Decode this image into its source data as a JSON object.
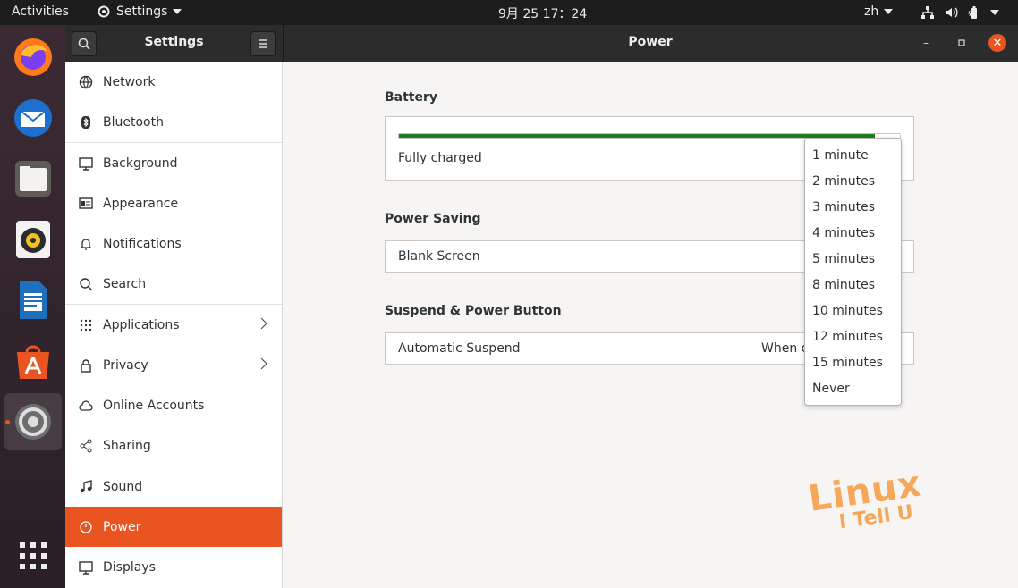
{
  "topbar": {
    "activities": "Activities",
    "app_menu": "Settings",
    "clock": "9月 25  17：24",
    "lang": "zh"
  },
  "sidebar": {
    "title": "Settings",
    "items": [
      {
        "label": "Network",
        "icon": "network-icon"
      },
      {
        "label": "Bluetooth",
        "icon": "bluetooth-icon"
      },
      {
        "label": "Background",
        "icon": "background-icon"
      },
      {
        "label": "Appearance",
        "icon": "appearance-icon"
      },
      {
        "label": "Notifications",
        "icon": "bell-icon"
      },
      {
        "label": "Search",
        "icon": "search-icon"
      },
      {
        "label": "Applications",
        "icon": "grid-icon"
      },
      {
        "label": "Privacy",
        "icon": "lock-icon"
      },
      {
        "label": "Online Accounts",
        "icon": "cloud-icon"
      },
      {
        "label": "Sharing",
        "icon": "share-icon"
      },
      {
        "label": "Sound",
        "icon": "music-icon"
      },
      {
        "label": "Power",
        "icon": "power-icon"
      },
      {
        "label": "Displays",
        "icon": "display-icon"
      }
    ],
    "selected": "Power"
  },
  "main": {
    "title": "Power",
    "battery": {
      "heading": "Battery",
      "status": "Fully charged",
      "level": 1.0
    },
    "power_saving": {
      "heading": "Power Saving",
      "blank_screen_label": "Blank Screen"
    },
    "suspend": {
      "heading": "Suspend & Power Button",
      "automatic_suspend_label": "Automatic Suspend",
      "automatic_suspend_value": "When o"
    }
  },
  "popover": {
    "options": [
      "1 minute",
      "2 minutes",
      "3 minutes",
      "4 minutes",
      "5 minutes",
      "8 minutes",
      "10 minutes",
      "12 minutes",
      "15 minutes",
      "Never"
    ]
  },
  "watermark": {
    "line1": "Linux",
    "line2": "I Tell U"
  },
  "colors": {
    "accent": "#e95420",
    "battery_fill": "#1d7d20"
  }
}
